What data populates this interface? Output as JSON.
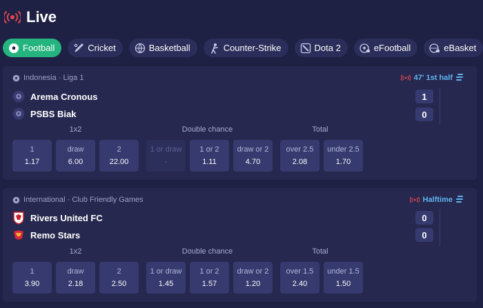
{
  "header": {
    "title": "Live"
  },
  "tabs": [
    {
      "label": "Football",
      "icon": "football-icon",
      "active": true
    },
    {
      "label": "Cricket",
      "icon": "cricket-icon"
    },
    {
      "label": "Basketball",
      "icon": "basketball-icon"
    },
    {
      "label": "Counter-Strike",
      "icon": "counter-strike-icon"
    },
    {
      "label": "Dota 2",
      "icon": "dota2-icon"
    },
    {
      "label": "eFootball",
      "icon": "efootball-icon"
    },
    {
      "label": "eBasket",
      "icon": "ebasketball-icon"
    }
  ],
  "colors": {
    "accent": "#24b47e",
    "background": "#1e2044",
    "card": "#26284f",
    "button": "#363a6e",
    "status": "#5fb5f0",
    "live": "#e0484f"
  },
  "matches": [
    {
      "league": "Indonesia · Liga 1",
      "status": "47' 1st half",
      "teams": [
        {
          "name": "Arema Cronous",
          "score": "1"
        },
        {
          "name": "PSBS Biak",
          "score": "0"
        }
      ],
      "markets": {
        "m1x2": "1x2",
        "double": "Double chance",
        "total": "Total"
      },
      "odds": [
        {
          "label": "1",
          "value": "1.17"
        },
        {
          "label": "draw",
          "value": "6.00"
        },
        {
          "label": "2",
          "value": "22.00"
        },
        {
          "label": "1 or draw",
          "value": "-"
        },
        {
          "label": "1 or 2",
          "value": "1.11"
        },
        {
          "label": "draw or 2",
          "value": "4.70"
        },
        {
          "label": "over 2.5",
          "value": "2.08"
        },
        {
          "label": "under 2.5",
          "value": "1.70"
        }
      ]
    },
    {
      "league": "International · Club Friendly Games",
      "status": "Halftime",
      "teams": [
        {
          "name": "Rivers United FC",
          "score": "0"
        },
        {
          "name": "Remo Stars",
          "score": "0"
        }
      ],
      "markets": {
        "m1x2": "1x2",
        "double": "Double chance",
        "total": "Total"
      },
      "odds": [
        {
          "label": "1",
          "value": "3.90"
        },
        {
          "label": "draw",
          "value": "2.18"
        },
        {
          "label": "2",
          "value": "2.50"
        },
        {
          "label": "1 or draw",
          "value": "1.45"
        },
        {
          "label": "1 or 2",
          "value": "1.57"
        },
        {
          "label": "draw or 2",
          "value": "1.20"
        },
        {
          "label": "over 1.5",
          "value": "2.40"
        },
        {
          "label": "under 1.5",
          "value": "1.50"
        }
      ]
    }
  ]
}
